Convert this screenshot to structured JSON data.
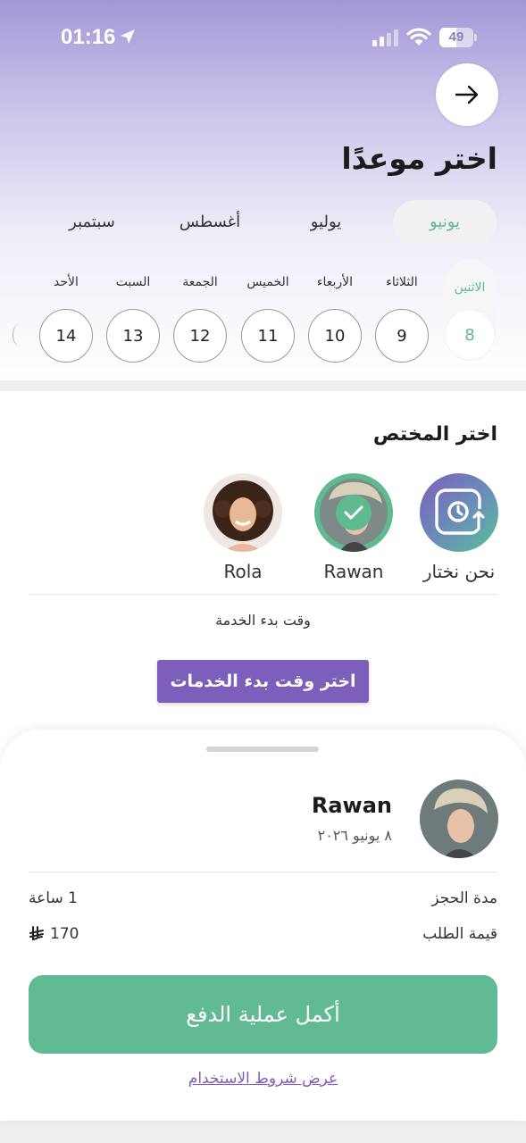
{
  "status_bar": {
    "time": "01:16",
    "battery": "49"
  },
  "header": {
    "title": "اختر موعدًا",
    "back_icon": "arrow-right-icon"
  },
  "months": [
    {
      "label": "يونيو",
      "active": true
    },
    {
      "label": "يوليو",
      "active": false
    },
    {
      "label": "أغسطس",
      "active": false
    },
    {
      "label": "سبتمبر",
      "active": false
    }
  ],
  "days": [
    {
      "name": "الاثنين",
      "number": "8",
      "active": true
    },
    {
      "name": "الثلاثاء",
      "number": "9",
      "active": false
    },
    {
      "name": "الأربعاء",
      "number": "10",
      "active": false
    },
    {
      "name": "الخميس",
      "number": "11",
      "active": false
    },
    {
      "name": "الجمعة",
      "number": "12",
      "active": false
    },
    {
      "name": "السبت",
      "number": "13",
      "active": false
    },
    {
      "name": "الأحد",
      "number": "14",
      "active": false
    }
  ],
  "specialist": {
    "title": "اختر المختص",
    "options": [
      {
        "name": "نحن نختار",
        "icon": "clock-rotate-icon",
        "selected": false
      },
      {
        "name": "Rawan",
        "selected": true
      },
      {
        "name": "Rola",
        "selected": false
      }
    ]
  },
  "service_start": {
    "label": "وقت بدء الخدمة",
    "button": "اختر وقت بدء الخدمات"
  },
  "summary": {
    "name": "Rawan",
    "date": "٨ يونيو ٢٠٢٦",
    "rows": [
      {
        "label": "مدة الحجز",
        "value": "1 ساعة"
      },
      {
        "label": "قيمة الطلب",
        "value": "170",
        "currency_icon": "saudi-riyal-icon"
      }
    ],
    "pay_button": "أكمل عملية الدفع",
    "terms_link": "عرض شروط الاستخدام"
  },
  "colors": {
    "accent_green": "#62ba95",
    "accent_purple": "#7b5fbb"
  }
}
